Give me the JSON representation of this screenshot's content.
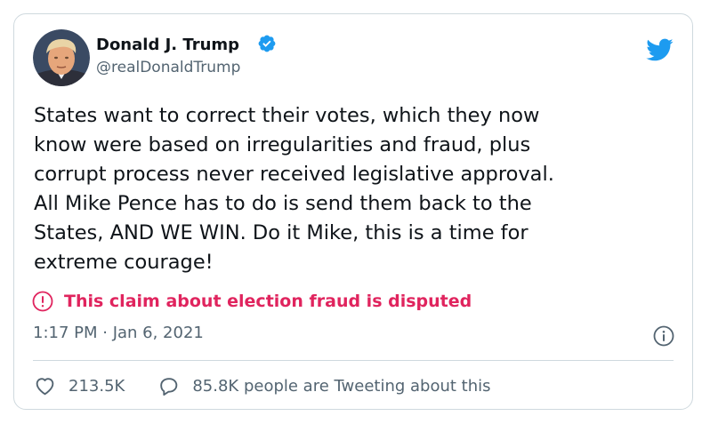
{
  "author": {
    "name": "Donald J. Trump",
    "handle": "@realDonaldTrump",
    "avatar_icon": "profile-avatar",
    "verified": true,
    "verified_color": "#1d9bf0"
  },
  "brand": {
    "logo_icon": "twitter-bird-icon",
    "color": "#1d9bf0"
  },
  "tweet": {
    "lines": [
      "States want to correct their votes, which they now",
      "know were based on irregularities and fraud, plus",
      "corrupt process never received legislative approval.",
      "All Mike Pence has to do is send them back to the",
      "States, AND WE WIN. Do it Mike, this is a time for",
      "extreme courage!"
    ]
  },
  "notice": {
    "icon": "exclamation-circle-icon",
    "text": "This claim about election fraud is disputed",
    "color": "#e0245e"
  },
  "timestamp": "1:17 PM · Jan 6, 2021",
  "info_icon": "info-circle-icon",
  "actions": {
    "like_icon": "heart-icon",
    "like_count": "213.5K",
    "reply_icon": "speech-bubble-icon",
    "reply_text": "85.8K people are Tweeting about this"
  }
}
